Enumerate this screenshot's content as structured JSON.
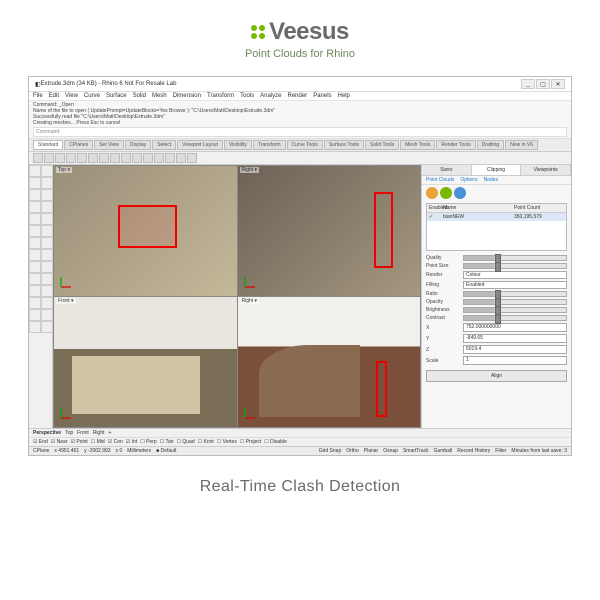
{
  "brand": {
    "word": "eesus",
    "subtitle": "Point Clouds for Rhino"
  },
  "caption": "Real-Time Clash Detection",
  "window": {
    "title": "Extrude.3dm (34 KB) - Rhino 6 Not For Resale Lab",
    "min": "_",
    "max": "▢",
    "close": "✕"
  },
  "menu": [
    "File",
    "Edit",
    "View",
    "Curve",
    "Surface",
    "Solid",
    "Mesh",
    "Dimension",
    "Transform",
    "Tools",
    "Analyze",
    "Render",
    "Panels",
    "Help"
  ],
  "cmd_history": [
    "Command: _Open",
    "Name of the file to open ( UpdatePrompt=UpdateBlocks=Yes  Browse ): \"C:\\Users\\Matt\\Desktop\\Extrude.3dm\"",
    "Successfully read file \"C:\\Users\\Matt\\Desktop\\Extrude.3dm\"",
    "Creating meshes... Press Esc to cancel"
  ],
  "cmd_prompt": "Command:",
  "tabs": [
    "Standard",
    "CPlanes",
    "Set View",
    "Display",
    "Select",
    "Viewport Layout",
    "Visibility",
    "Transform",
    "Curve Tools",
    "Surface Tools",
    "Solid Tools",
    "Mesh Tools",
    "Render Tools",
    "Drafting",
    "New in V6"
  ],
  "viewports": {
    "tl": "Top ▾",
    "tr": "Right ▾",
    "bl": "Front ▾",
    "br": "Right ▾"
  },
  "right": {
    "tabs": [
      "Sizes",
      "Clipping",
      "Viewpoints"
    ],
    "subtabs": [
      "Point Clouds",
      "Options",
      "Nodes"
    ],
    "btn_colors": [
      "#e8a33a",
      "#7ab800",
      "#4a90d9"
    ],
    "list_head": [
      "Enabled",
      "Name",
      "Point Count"
    ],
    "row": {
      "enabled": "✓",
      "name": "bianNEW",
      "count": "350,195,579"
    },
    "props": {
      "quality_label": "Quality",
      "pointsize_label": "Point Size",
      "render_label": "Render",
      "render_value": "Colour",
      "filling_label": "Filling",
      "filling_value": "Enabled",
      "ratio_label": "Ratio",
      "opacity_label": "Opacity",
      "brightness_label": "Brightness",
      "contrast_label": "Contrast",
      "x_label": "X",
      "x_value": "752.000000000",
      "y_label": "Y",
      "y_value": "-849.65",
      "z_label": "Z",
      "z_value": "5019.4",
      "scale_label": "Scale",
      "scale_value": "1"
    },
    "align": "Align"
  },
  "footer_tabs": [
    "Perspective",
    "Top",
    "Front",
    "Right",
    "+"
  ],
  "options": {
    "checks": [
      "End",
      "Near",
      "Point",
      "Mid",
      "Cen",
      "Int",
      "Perp",
      "Tan",
      "Quad",
      "Knot",
      "Vertex",
      "Project",
      "Disable"
    ],
    "checked": [
      "End",
      "Near",
      "Point",
      "Cen",
      "Int"
    ]
  },
  "status": {
    "cplane": "CPlane",
    "x": "x 4951.461",
    "y": "y -2002.993",
    "z": "z 0",
    "units": "Millimeters",
    "layer": "■ Default",
    "toggles": [
      "Grid Snap",
      "Ortho",
      "Planar",
      "Osnap",
      "SmartTrack",
      "Gumball",
      "Record History",
      "Filter"
    ],
    "msg": "Minutes from last save: 3"
  }
}
